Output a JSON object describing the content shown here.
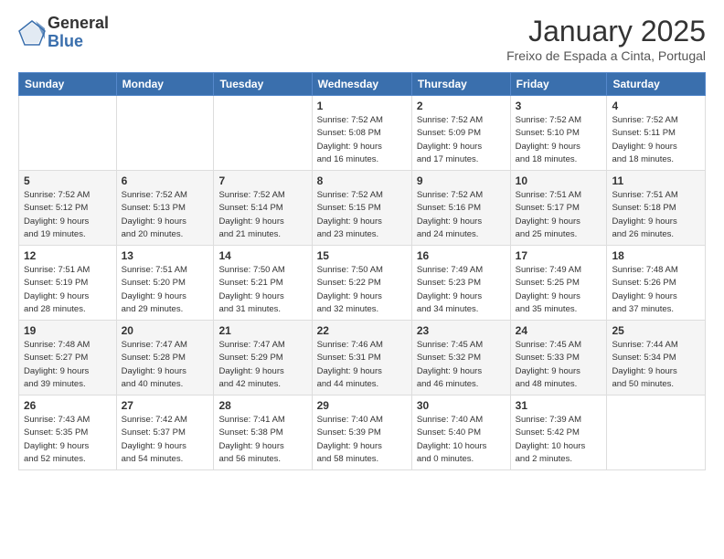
{
  "logo": {
    "general": "General",
    "blue": "Blue"
  },
  "header": {
    "month": "January 2025",
    "location": "Freixo de Espada a Cinta, Portugal"
  },
  "weekdays": [
    "Sunday",
    "Monday",
    "Tuesday",
    "Wednesday",
    "Thursday",
    "Friday",
    "Saturday"
  ],
  "weeks": [
    [
      {
        "day": "",
        "info": ""
      },
      {
        "day": "",
        "info": ""
      },
      {
        "day": "",
        "info": ""
      },
      {
        "day": "1",
        "info": "Sunrise: 7:52 AM\nSunset: 5:08 PM\nDaylight: 9 hours\nand 16 minutes."
      },
      {
        "day": "2",
        "info": "Sunrise: 7:52 AM\nSunset: 5:09 PM\nDaylight: 9 hours\nand 17 minutes."
      },
      {
        "day": "3",
        "info": "Sunrise: 7:52 AM\nSunset: 5:10 PM\nDaylight: 9 hours\nand 18 minutes."
      },
      {
        "day": "4",
        "info": "Sunrise: 7:52 AM\nSunset: 5:11 PM\nDaylight: 9 hours\nand 18 minutes."
      }
    ],
    [
      {
        "day": "5",
        "info": "Sunrise: 7:52 AM\nSunset: 5:12 PM\nDaylight: 9 hours\nand 19 minutes."
      },
      {
        "day": "6",
        "info": "Sunrise: 7:52 AM\nSunset: 5:13 PM\nDaylight: 9 hours\nand 20 minutes."
      },
      {
        "day": "7",
        "info": "Sunrise: 7:52 AM\nSunset: 5:14 PM\nDaylight: 9 hours\nand 21 minutes."
      },
      {
        "day": "8",
        "info": "Sunrise: 7:52 AM\nSunset: 5:15 PM\nDaylight: 9 hours\nand 23 minutes."
      },
      {
        "day": "9",
        "info": "Sunrise: 7:52 AM\nSunset: 5:16 PM\nDaylight: 9 hours\nand 24 minutes."
      },
      {
        "day": "10",
        "info": "Sunrise: 7:51 AM\nSunset: 5:17 PM\nDaylight: 9 hours\nand 25 minutes."
      },
      {
        "day": "11",
        "info": "Sunrise: 7:51 AM\nSunset: 5:18 PM\nDaylight: 9 hours\nand 26 minutes."
      }
    ],
    [
      {
        "day": "12",
        "info": "Sunrise: 7:51 AM\nSunset: 5:19 PM\nDaylight: 9 hours\nand 28 minutes."
      },
      {
        "day": "13",
        "info": "Sunrise: 7:51 AM\nSunset: 5:20 PM\nDaylight: 9 hours\nand 29 minutes."
      },
      {
        "day": "14",
        "info": "Sunrise: 7:50 AM\nSunset: 5:21 PM\nDaylight: 9 hours\nand 31 minutes."
      },
      {
        "day": "15",
        "info": "Sunrise: 7:50 AM\nSunset: 5:22 PM\nDaylight: 9 hours\nand 32 minutes."
      },
      {
        "day": "16",
        "info": "Sunrise: 7:49 AM\nSunset: 5:23 PM\nDaylight: 9 hours\nand 34 minutes."
      },
      {
        "day": "17",
        "info": "Sunrise: 7:49 AM\nSunset: 5:25 PM\nDaylight: 9 hours\nand 35 minutes."
      },
      {
        "day": "18",
        "info": "Sunrise: 7:48 AM\nSunset: 5:26 PM\nDaylight: 9 hours\nand 37 minutes."
      }
    ],
    [
      {
        "day": "19",
        "info": "Sunrise: 7:48 AM\nSunset: 5:27 PM\nDaylight: 9 hours\nand 39 minutes."
      },
      {
        "day": "20",
        "info": "Sunrise: 7:47 AM\nSunset: 5:28 PM\nDaylight: 9 hours\nand 40 minutes."
      },
      {
        "day": "21",
        "info": "Sunrise: 7:47 AM\nSunset: 5:29 PM\nDaylight: 9 hours\nand 42 minutes."
      },
      {
        "day": "22",
        "info": "Sunrise: 7:46 AM\nSunset: 5:31 PM\nDaylight: 9 hours\nand 44 minutes."
      },
      {
        "day": "23",
        "info": "Sunrise: 7:45 AM\nSunset: 5:32 PM\nDaylight: 9 hours\nand 46 minutes."
      },
      {
        "day": "24",
        "info": "Sunrise: 7:45 AM\nSunset: 5:33 PM\nDaylight: 9 hours\nand 48 minutes."
      },
      {
        "day": "25",
        "info": "Sunrise: 7:44 AM\nSunset: 5:34 PM\nDaylight: 9 hours\nand 50 minutes."
      }
    ],
    [
      {
        "day": "26",
        "info": "Sunrise: 7:43 AM\nSunset: 5:35 PM\nDaylight: 9 hours\nand 52 minutes."
      },
      {
        "day": "27",
        "info": "Sunrise: 7:42 AM\nSunset: 5:37 PM\nDaylight: 9 hours\nand 54 minutes."
      },
      {
        "day": "28",
        "info": "Sunrise: 7:41 AM\nSunset: 5:38 PM\nDaylight: 9 hours\nand 56 minutes."
      },
      {
        "day": "29",
        "info": "Sunrise: 7:40 AM\nSunset: 5:39 PM\nDaylight: 9 hours\nand 58 minutes."
      },
      {
        "day": "30",
        "info": "Sunrise: 7:40 AM\nSunset: 5:40 PM\nDaylight: 10 hours\nand 0 minutes."
      },
      {
        "day": "31",
        "info": "Sunrise: 7:39 AM\nSunset: 5:42 PM\nDaylight: 10 hours\nand 2 minutes."
      },
      {
        "day": "",
        "info": ""
      }
    ]
  ]
}
